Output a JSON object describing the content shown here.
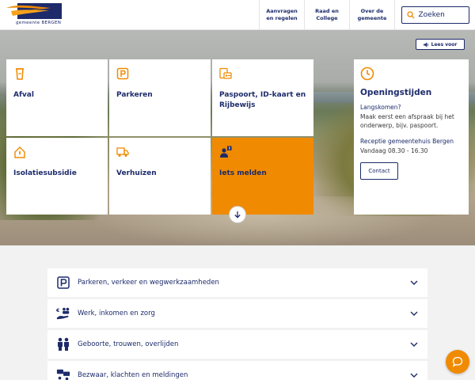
{
  "header": {
    "logo_text": "gemeente BERGEN",
    "nav": [
      {
        "label": "Aanvragen en regelen"
      },
      {
        "label": "Raad en College"
      },
      {
        "label": "Over de gemeente"
      }
    ],
    "search": {
      "placeholder": "Zoeken",
      "icon": "search-icon"
    }
  },
  "hero": {
    "read_aloud": "Lees voor",
    "tiles": [
      {
        "label": "Afval",
        "icon": "waste-bin-icon"
      },
      {
        "label": "Parkeren",
        "icon": "parking-icon"
      },
      {
        "label": "Paspoort, ID-kaart en Rijbewijs",
        "icon": "id-card-icon"
      },
      {
        "label": "Isolatiesubsidie",
        "icon": "house-insulation-icon"
      },
      {
        "label": "Verhuizen",
        "icon": "moving-truck-icon"
      },
      {
        "label": "Iets melden",
        "icon": "report-person-icon"
      }
    ],
    "hours": {
      "title": "Openingstijden",
      "visit_title": "Langskomen?",
      "visit_text": "Maak eerst een afspraak bij het onderwerp, bijv. paspoort.",
      "reception_title": "Receptie gemeentehuis Bergen",
      "reception_text": "Vandaag 08.30 - 16.30",
      "contact_label": "Contact",
      "icon": "clock-icon"
    }
  },
  "topics": [
    {
      "label": "Parkeren, verkeer en wegwerkzaamheden",
      "icon": "parking-icon"
    },
    {
      "label": "Werk, inkomen en zorg",
      "icon": "income-care-icon"
    },
    {
      "label": "Geboorte, trouwen, overlijden",
      "icon": "family-icon"
    },
    {
      "label": "Bezwaar, klachten en meldingen",
      "icon": "complaint-icon"
    }
  ],
  "colors": {
    "navy": "#1d2b6b",
    "orange": "#f08a00"
  }
}
